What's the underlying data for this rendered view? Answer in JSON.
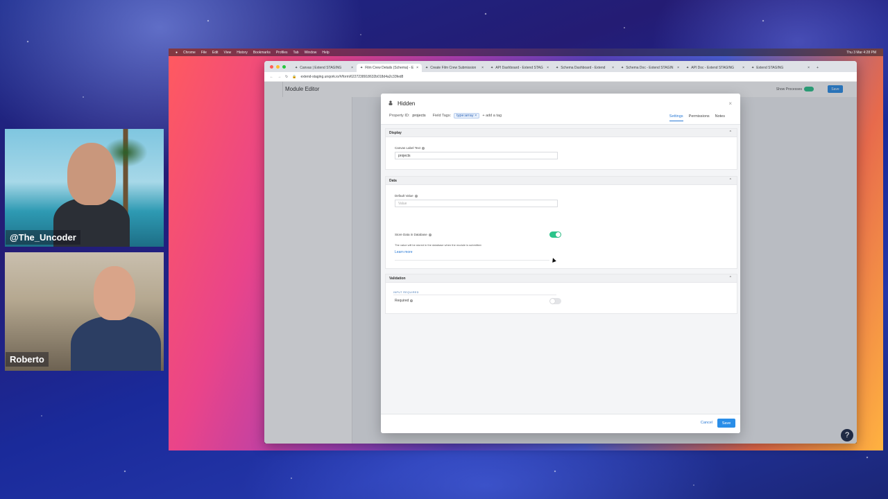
{
  "stream": {
    "guest_top_name": "@The_Uncoder",
    "guest_bottom_name": "Roberto"
  },
  "menubar": {
    "app": "Chrome",
    "items": [
      "File",
      "Edit",
      "View",
      "History",
      "Bookmarks",
      "Profiles",
      "Tab",
      "Window",
      "Help"
    ],
    "clock": "Thu 3 Mar 4:28 PM"
  },
  "browser": {
    "tabs": [
      {
        "label": "Canvas | Extend STAGING"
      },
      {
        "label": "Film Crew Details (Schema) - E"
      },
      {
        "label": "Create Film Crew Submission"
      },
      {
        "label": "API Dashboard - Extend STAG"
      },
      {
        "label": "Schema Dashboard - Extend"
      },
      {
        "label": "Schema Doc - Extend STAGIN"
      },
      {
        "label": "API Doc - Extend STAGING"
      },
      {
        "label": "Extend STAGING"
      }
    ],
    "url": "extend-staging.unqork.io/#/form/6227238918632b018d4a2c33fed8"
  },
  "app": {
    "title": "Module Editor",
    "show_processes": "Show Processes",
    "save": "Save"
  },
  "modal": {
    "title": "Hidden",
    "property_id_label": "Property ID:",
    "property_id": "projects",
    "field_tags_label": "Field Tags:",
    "tag": "type:array",
    "add_tag": "+ add a tag",
    "tabs": [
      "Settings",
      "Permissions",
      "Notes"
    ],
    "display": {
      "heading": "Display",
      "canvas_label": "Canvas Label Text",
      "canvas_value": "projects"
    },
    "data": {
      "heading": "Data",
      "default_value_label": "Default Value",
      "default_value_placeholder": "Value",
      "store_label": "Store Data in Database",
      "store_desc": "The value will be stored in the database when the module is submitted.",
      "learn_more": "Learn more",
      "store_enabled": true
    },
    "validation": {
      "heading": "Validation",
      "caption": "INPUT REQUIRED",
      "required_label": "Required",
      "required_enabled": false
    },
    "cancel": "Cancel",
    "save": "Save"
  },
  "help_glyph": "?",
  "colors": {
    "accent": "#2a8ee8",
    "toggle_on": "#2bc48a"
  }
}
